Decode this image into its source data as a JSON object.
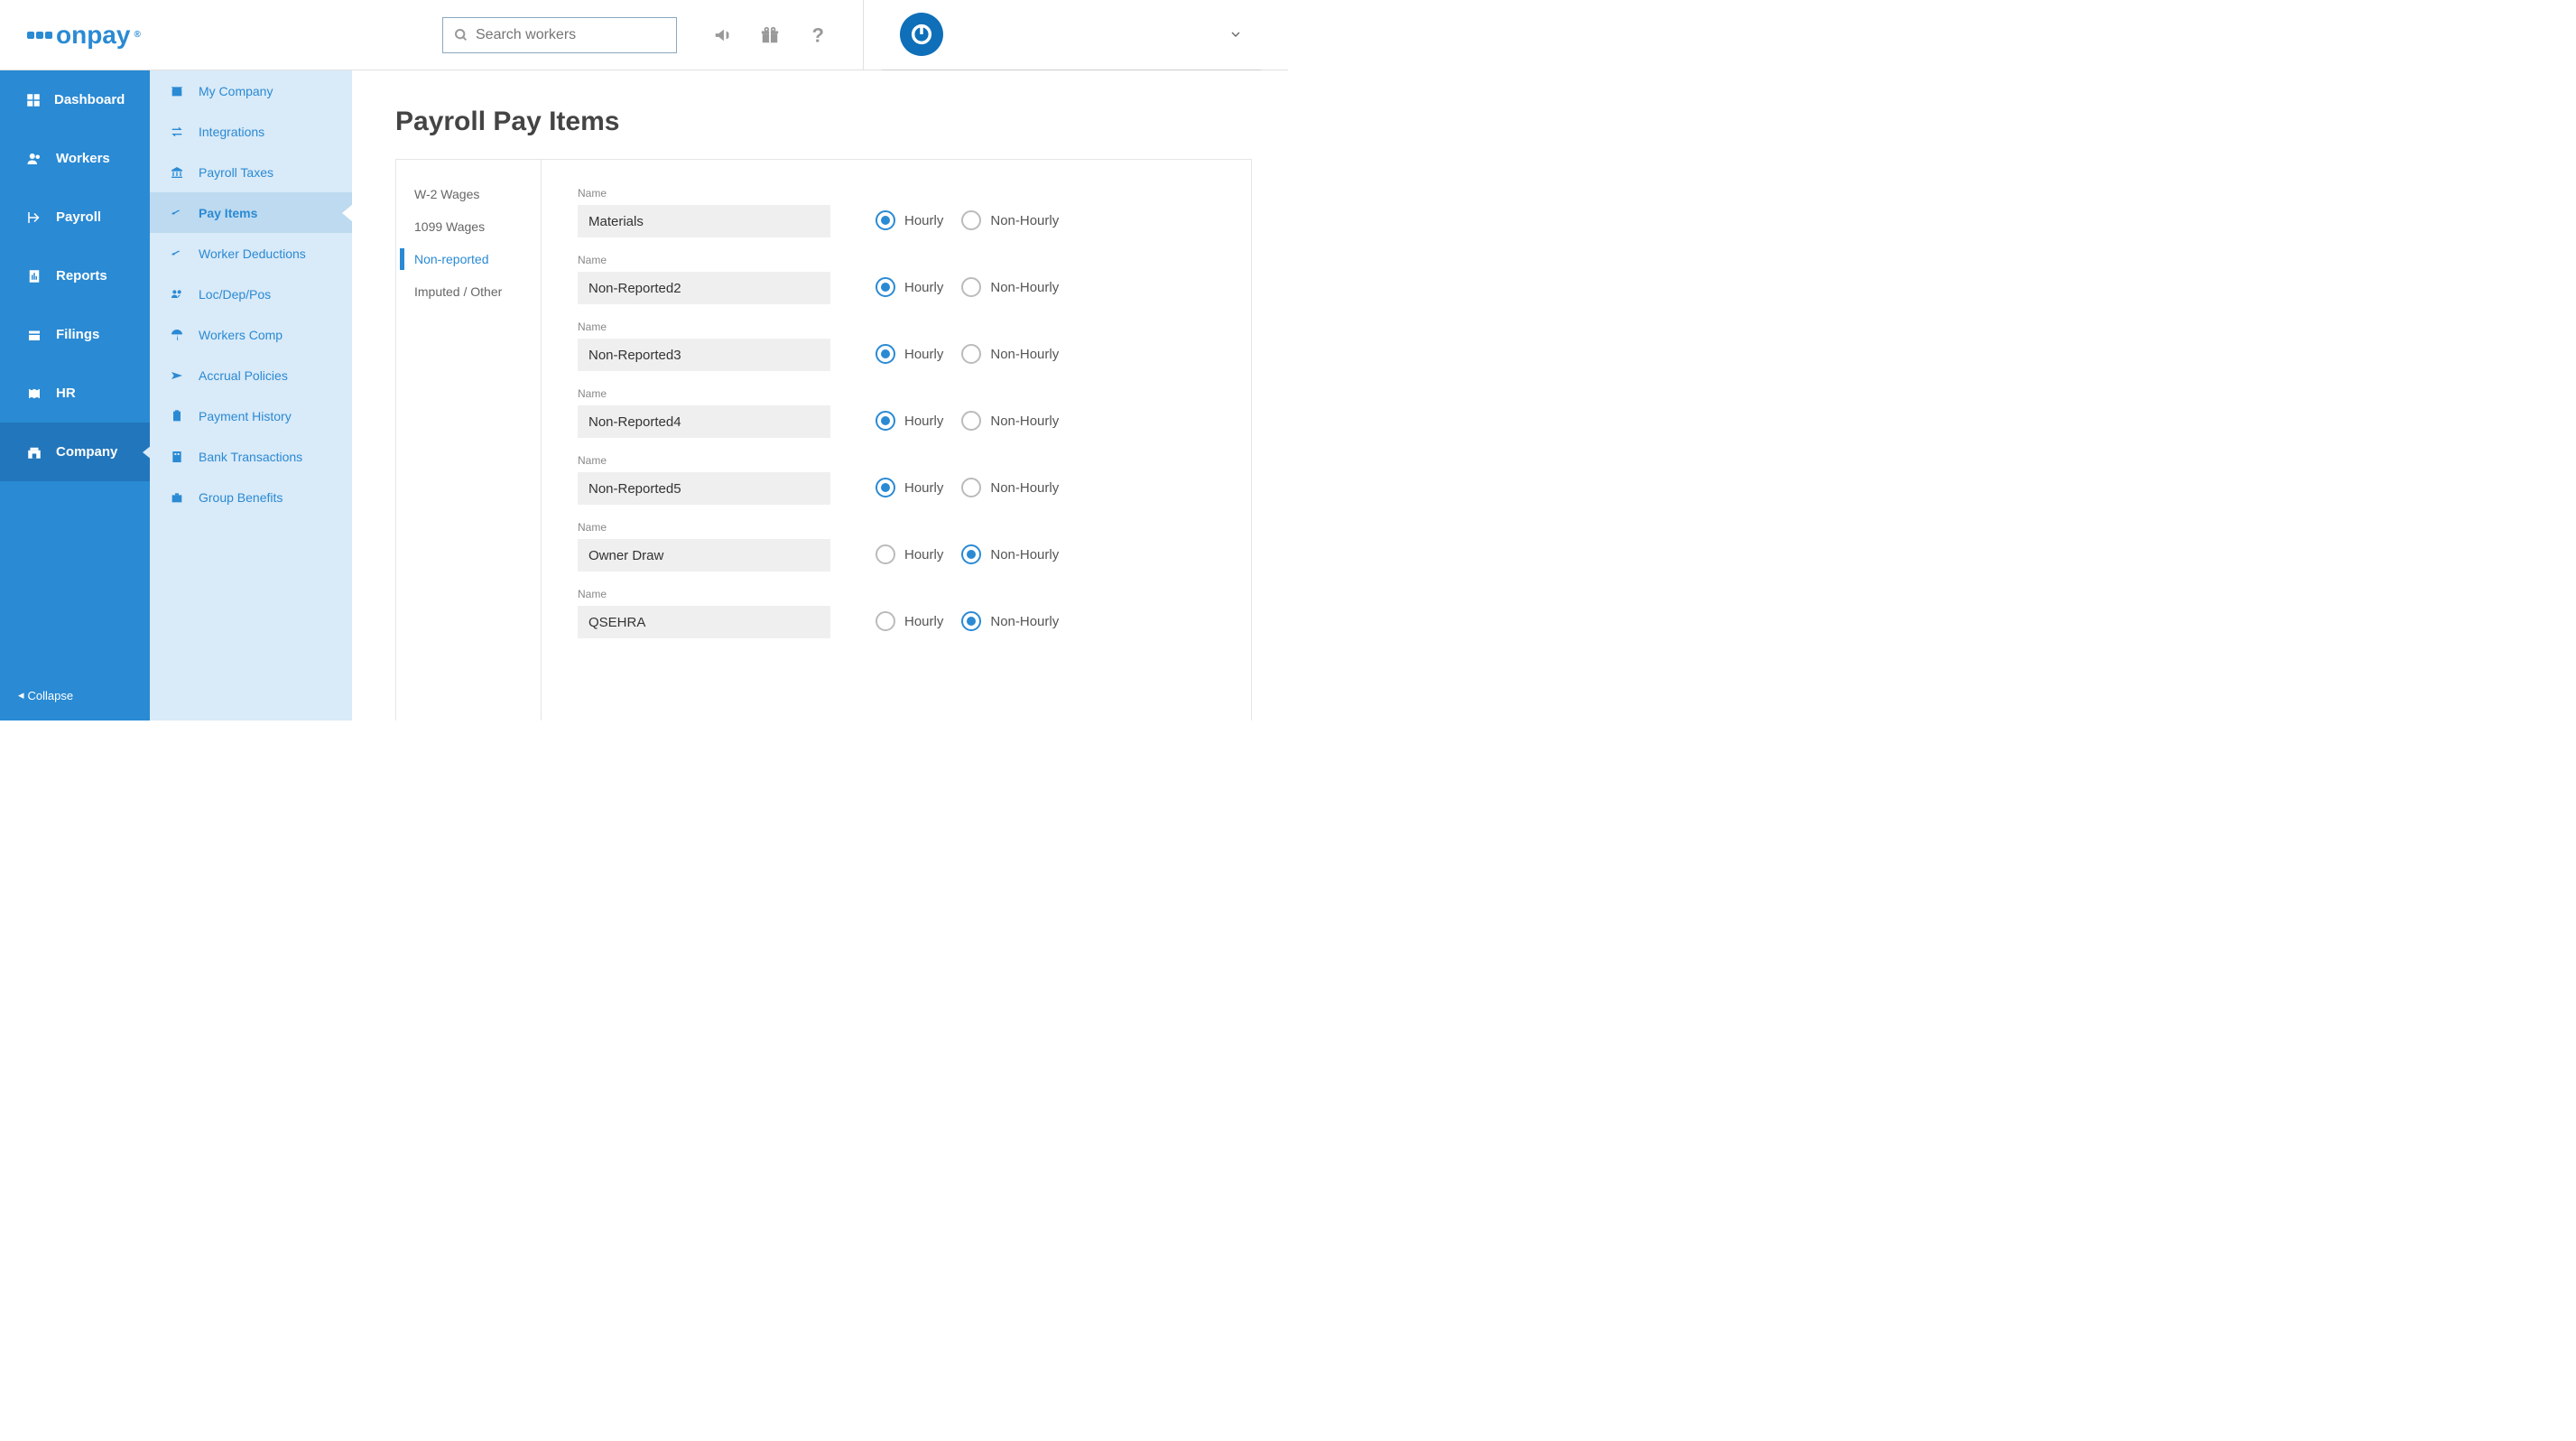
{
  "header": {
    "logo": "onpay",
    "search_placeholder": "Search workers"
  },
  "sidebar_main": {
    "items": [
      {
        "label": "Dashboard",
        "icon": "dashboard"
      },
      {
        "label": "Workers",
        "icon": "workers"
      },
      {
        "label": "Payroll",
        "icon": "payroll"
      },
      {
        "label": "Reports",
        "icon": "reports"
      },
      {
        "label": "Filings",
        "icon": "filings"
      },
      {
        "label": "HR",
        "icon": "hr"
      },
      {
        "label": "Company",
        "icon": "company"
      }
    ],
    "collapse": "Collapse"
  },
  "sidebar_sub": {
    "items": [
      {
        "label": "My Company",
        "icon": "store"
      },
      {
        "label": "Integrations",
        "icon": "swap"
      },
      {
        "label": "Payroll Taxes",
        "icon": "bank"
      },
      {
        "label": "Pay Items",
        "icon": "pay"
      },
      {
        "label": "Worker Deductions",
        "icon": "deduct"
      },
      {
        "label": "Loc/Dep/Pos",
        "icon": "people"
      },
      {
        "label": "Workers Comp",
        "icon": "umbrella"
      },
      {
        "label": "Accrual Policies",
        "icon": "plane"
      },
      {
        "label": "Payment History",
        "icon": "clipboard"
      },
      {
        "label": "Bank Transactions",
        "icon": "building"
      },
      {
        "label": "Group Benefits",
        "icon": "briefcase"
      }
    ],
    "active_index": 3
  },
  "page": {
    "title": "Payroll Pay Items",
    "tabs": [
      {
        "label": "W-2 Wages"
      },
      {
        "label": "1099 Wages"
      },
      {
        "label": "Non-reported"
      },
      {
        "label": "Imputed / Other"
      }
    ],
    "active_tab": 2,
    "field_label": "Name",
    "radio_labels": {
      "hourly": "Hourly",
      "non_hourly": "Non-Hourly"
    },
    "pay_items": [
      {
        "name": "Materials",
        "type": "hourly"
      },
      {
        "name": "Non-Reported2",
        "type": "hourly"
      },
      {
        "name": "Non-Reported3",
        "type": "hourly"
      },
      {
        "name": "Non-Reported4",
        "type": "hourly"
      },
      {
        "name": "Non-Reported5",
        "type": "hourly"
      },
      {
        "name": "Owner Draw",
        "type": "non_hourly"
      },
      {
        "name": "QSEHRA",
        "type": "non_hourly"
      }
    ]
  }
}
